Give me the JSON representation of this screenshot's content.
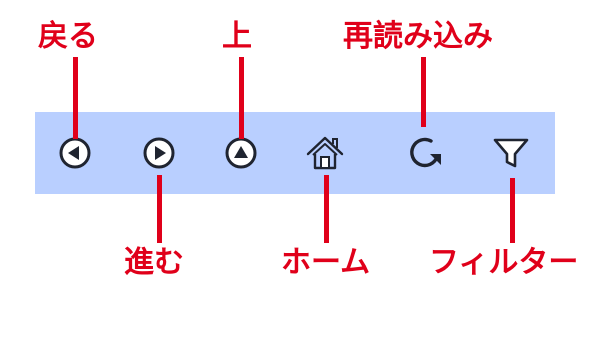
{
  "annotations": {
    "back": "戻る",
    "forward": "進む",
    "up": "上",
    "home": "ホーム",
    "reload": "再読み込み",
    "filter": "フィルター"
  },
  "icons": {
    "back": "back-circle-arrow-icon",
    "forward": "forward-circle-arrow-icon",
    "up": "up-circle-arrow-icon",
    "home": "home-icon",
    "reload": "reload-icon",
    "filter": "filter-funnel-icon"
  },
  "colors": {
    "toolbar_background": "#b9cfff",
    "annotation_red": "#e0001a",
    "icon_color": "#1f2430"
  }
}
